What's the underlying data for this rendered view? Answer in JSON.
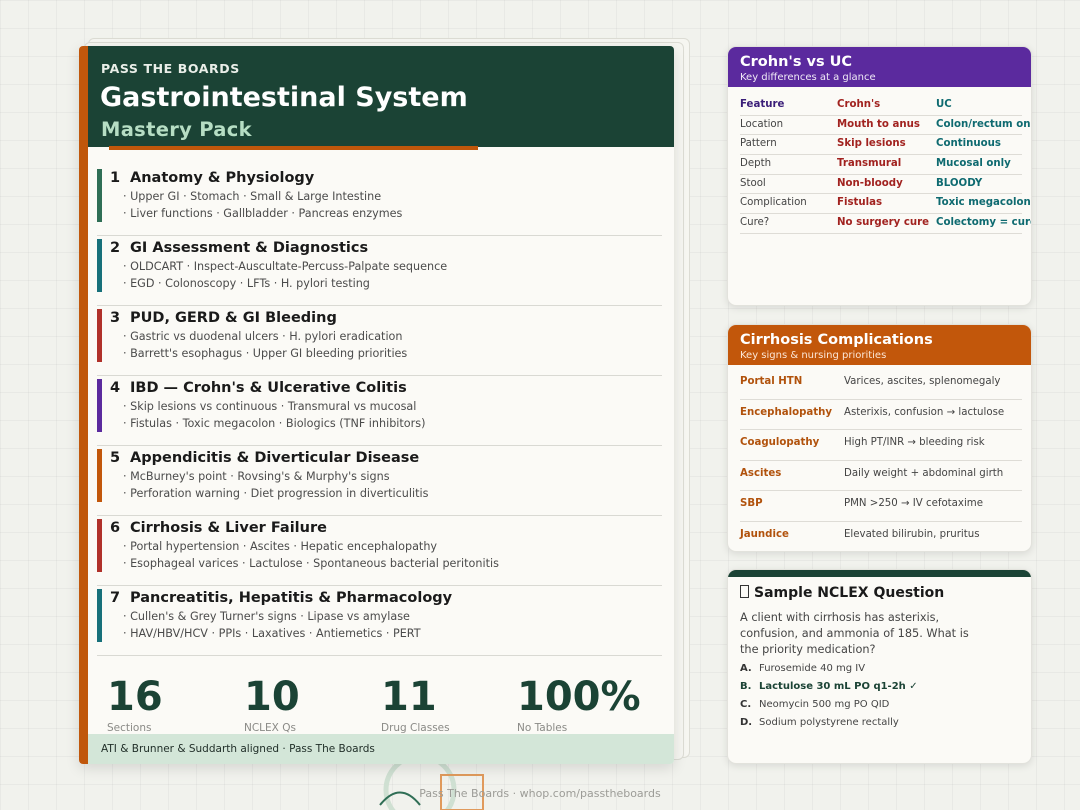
{
  "pack": {
    "brand": "PASS THE BOARDS",
    "title": "Gastrointestinal System",
    "subtitle": "Mastery Pack",
    "sections": [
      {
        "num": "1",
        "title": "Anatomy & Physiology",
        "line1": "· Upper GI · Stomach · Small & Large Intestine",
        "line2": "· Liver functions · Gallbladder · Pancreas enzymes",
        "color": "#2f6e55"
      },
      {
        "num": "2",
        "title": "GI Assessment & Diagnostics",
        "line1": "· OLDCART · Inspect-Auscultate-Percuss-Palpate sequence",
        "line2": "· EGD · Colonoscopy · LFTs · H. pylori testing",
        "color": "#17707a"
      },
      {
        "num": "3",
        "title": "PUD, GERD & GI Bleeding",
        "line1": "· Gastric vs duodenal ulcers · H. pylori eradication",
        "line2": "· Barrett's esophagus · Upper GI bleeding priorities",
        "color": "#b0312a"
      },
      {
        "num": "4",
        "title": "IBD — Crohn's & Ulcerative Colitis",
        "line1": "· Skip lesions vs continuous · Transmural vs mucosal",
        "line2": "· Fistulas · Toxic megacolon · Biologics (TNF inhibitors)",
        "color": "#5b2a9e"
      },
      {
        "num": "5",
        "title": "Appendicitis & Diverticular Disease",
        "line1": "· McBurney's point · Rovsing's & Murphy's signs",
        "line2": "· Perforation warning · Diet progression in diverticulitis",
        "color": "#c2570b"
      },
      {
        "num": "6",
        "title": "Cirrhosis & Liver Failure",
        "line1": "· Portal hypertension · Ascites · Hepatic encephalopathy",
        "line2": "· Esophageal varices · Lactulose · Spontaneous bacterial peritonitis",
        "color": "#b0312a"
      },
      {
        "num": "7",
        "title": "Pancreatitis, Hepatitis & Pharmacology",
        "line1": "· Cullen's & Grey Turner's signs · Lipase vs amylase",
        "line2": "· HAV/HBV/HCV · PPIs · Laxatives · Antiemetics · PERT",
        "color": "#17707a"
      }
    ],
    "stats": [
      {
        "value": "16",
        "label": "Sections"
      },
      {
        "value": "10",
        "label": "NCLEX Qs"
      },
      {
        "value": "11",
        "label": "Drug Classes"
      },
      {
        "value": "100%",
        "label": "No Tables"
      }
    ],
    "footer": "ATI & Brunner & Suddarth aligned · Pass The Boards"
  },
  "crohn_card": {
    "title": "Crohn's vs UC",
    "subtitle": "Key differences at a glance",
    "header": [
      "Feature",
      "Crohn's",
      "UC"
    ],
    "rows": [
      [
        "Location",
        "Mouth to anus",
        "Colon/rectum only"
      ],
      [
        "Pattern",
        "Skip lesions",
        "Continuous"
      ],
      [
        "Depth",
        "Transmural",
        "Mucosal only"
      ],
      [
        "Stool",
        "Non-bloody",
        "BLOODY"
      ],
      [
        "Complication",
        "Fistulas",
        "Toxic megacolon"
      ],
      [
        "Cure?",
        "No surgery cure",
        "Colectomy = cure"
      ]
    ]
  },
  "cirrhosis_card": {
    "title": "Cirrhosis Complications",
    "subtitle": "Key signs & nursing priorities",
    "rows": [
      [
        "Portal HTN",
        "Varices, ascites, splenomegaly"
      ],
      [
        "Encephalopathy",
        "Asterixis, confusion → lactulose"
      ],
      [
        "Coagulopathy",
        "High PT/INR → bleeding risk"
      ],
      [
        "Ascites",
        "Daily weight + abdominal girth"
      ],
      [
        "SBP",
        "PMN >250 → IV cefotaxime"
      ],
      [
        "Jaundice",
        "Elevated bilirubin, pruritus"
      ]
    ]
  },
  "nclex_card": {
    "title": "Sample NCLEX Question",
    "stem": "A client with cirrhosis has asterixis, confusion, and ammonia of 185. What is the priority medication?",
    "options": [
      {
        "letter": "A.",
        "text": "Furosemide 40 mg IV",
        "correct": false
      },
      {
        "letter": "B.",
        "text": "Lactulose 30 mL PO q1-2h ✓",
        "correct": true
      },
      {
        "letter": "C.",
        "text": "Neomycin 500 mg PO QID",
        "correct": false
      },
      {
        "letter": "D.",
        "text": "Sodium polystyrene rectally",
        "correct": false
      }
    ]
  },
  "site_footer": "Pass The Boards  ·  whop.com/passtheboards"
}
